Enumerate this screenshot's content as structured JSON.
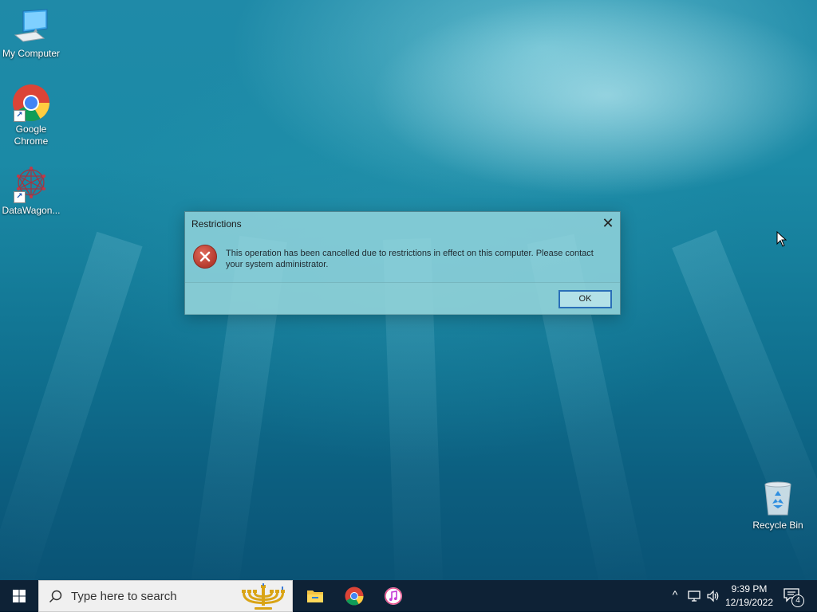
{
  "desktop": {
    "icons": [
      {
        "label": "My Computer",
        "icon": "computer-icon"
      },
      {
        "label": "Google Chrome",
        "icon": "chrome-icon",
        "shortcut": true
      },
      {
        "label": "DataWagon...",
        "icon": "datawagon-icon",
        "shortcut": true
      },
      {
        "label": "Recycle Bin",
        "icon": "recycle-bin-icon"
      }
    ]
  },
  "dialog": {
    "title": "Restrictions",
    "close_glyph": "✕",
    "icon": "error-icon",
    "message": "This operation has been cancelled due to restrictions in effect on this computer. Please contact your system administrator.",
    "ok_label": "OK"
  },
  "taskbar": {
    "start_icon": "windows-logo-icon",
    "search_placeholder": "Type here to search",
    "search_decoration": "menorah-icon",
    "pinned_apps": [
      {
        "name": "File Explorer",
        "icon": "file-explorer-icon"
      },
      {
        "name": "Google Chrome",
        "icon": "chrome-icon"
      },
      {
        "name": "iTunes",
        "icon": "itunes-icon"
      }
    ],
    "tray": {
      "chevron": "^",
      "time": "9:39 PM",
      "date": "12/19/2022",
      "notification_count": "4"
    }
  },
  "colors": {
    "taskbar_bg": "#0e2236",
    "dialog_bg": "#96d7de",
    "ok_border": "#2a6fb8",
    "error_red": "#b53a2e"
  }
}
